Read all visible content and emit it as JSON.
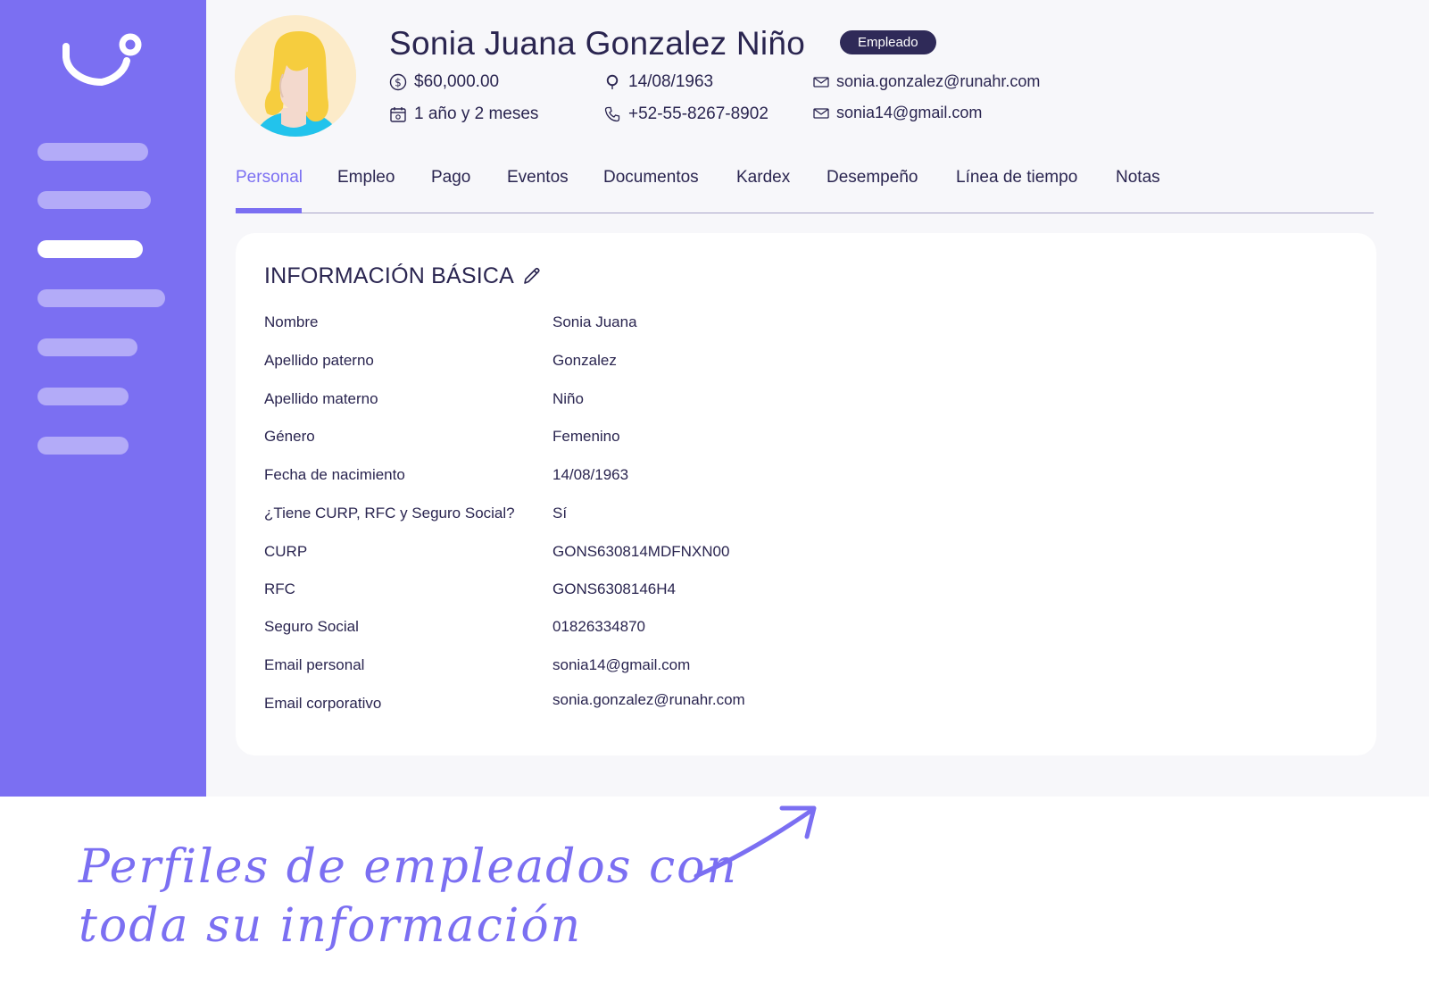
{
  "profile": {
    "name": "Sonia Juana Gonzalez Niño",
    "badge": "Empleado",
    "salary": "$60,000.00",
    "tenure": "1 año y 2 meses",
    "birthdate": "14/08/1963",
    "phone": "+52-55-8267-8902",
    "email_corporate": "sonia.gonzalez@runahr.com",
    "email_personal": "sonia14@gmail.com"
  },
  "tabs": [
    {
      "label": "Personal",
      "active": true
    },
    {
      "label": "Empleo"
    },
    {
      "label": "Pago"
    },
    {
      "label": "Eventos"
    },
    {
      "label": "Documentos"
    },
    {
      "label": "Kardex"
    },
    {
      "label": "Desempeño"
    },
    {
      "label": "Línea de tiempo"
    },
    {
      "label": "Notas"
    }
  ],
  "basic_info": {
    "title": "INFORMACIÓN BÁSICA",
    "rows": [
      {
        "label": "Nombre",
        "value": "Sonia Juana"
      },
      {
        "label": "Apellido paterno",
        "value": "Gonzalez"
      },
      {
        "label": "Apellido materno",
        "value": "Niño"
      },
      {
        "label": "Género",
        "value": "Femenino"
      },
      {
        "label": "Fecha de nacimiento",
        "value": "14/08/1963"
      },
      {
        "label": "¿Tiene CURP, RFC y Seguro Social?",
        "value": "Sí"
      },
      {
        "label": "CURP",
        "value": "GONS630814MDFNXN00"
      },
      {
        "label": "RFC",
        "value": "GONS6308146H4"
      },
      {
        "label": "Seguro Social",
        "value": "01826334870"
      },
      {
        "label": "Email personal",
        "value": "sonia14@gmail.com"
      },
      {
        "label": "Email corporativo",
        "value": "sonia.gonzalez@runahr.com"
      }
    ]
  },
  "caption": {
    "line1": "Perfiles de empleados con",
    "line2": "toda su información"
  },
  "colors": {
    "brand": "#7b6ff2",
    "nav_pill": "#b3abf8",
    "text": "#2a2550",
    "badge_bg": "#2f2a58",
    "background": "#f7f7fa"
  },
  "icons": {
    "logo": "runa-logo",
    "salary": "dollar-circle-icon",
    "tenure": "calendar-icon",
    "birthdate": "location-pin-icon",
    "phone": "phone-icon",
    "email": "mail-icon",
    "edit": "pencil-icon"
  }
}
